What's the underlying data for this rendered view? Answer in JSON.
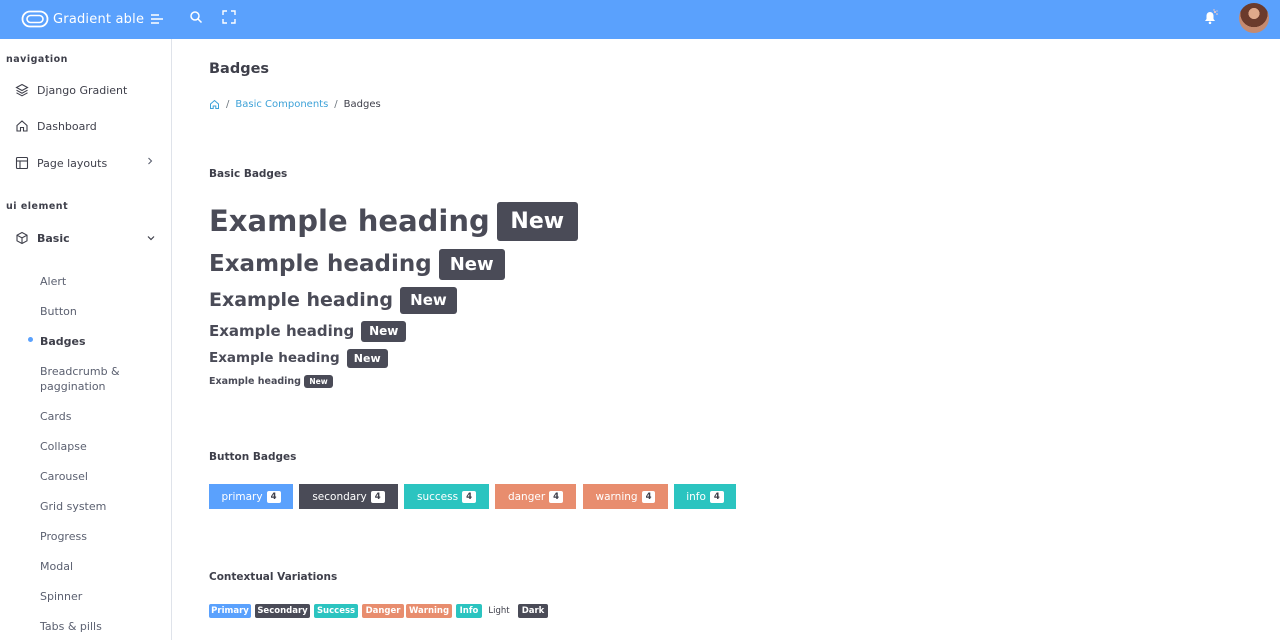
{
  "header": {
    "logo_text": "Gradient able",
    "bar_color": "#5aa1fd",
    "icons": [
      "menu-icon",
      "search-icon",
      "fullscreen-icon",
      "bell-icon",
      "avatar"
    ]
  },
  "sidebar": {
    "caption_navigation": "navigation",
    "items_navigation": [
      {
        "label": "Django Gradient",
        "icon": "layers-icon"
      },
      {
        "label": "Dashboard",
        "icon": "home-icon"
      },
      {
        "label": "Page layouts",
        "icon": "layout-icon"
      }
    ],
    "caption_ui": "ui element",
    "basic": {
      "label": "Basic",
      "icon": "box-icon"
    },
    "sub_items": [
      "Alert",
      "Button",
      "Badges",
      "Breadcrumb &",
      "paggination",
      "Cards",
      "Collapse",
      "Carousel",
      "Grid system",
      "Progress",
      "Modal",
      "Spinner",
      "Tabs & pills"
    ]
  },
  "page": {
    "title": "Badges",
    "breadcrumb": {
      "link": "Basic Components",
      "current": "Badges"
    }
  },
  "basic_badges": {
    "title": "Basic Badges",
    "heading_text": "Example heading",
    "badge_text": "New"
  },
  "button_badges": {
    "title": "Button Badges",
    "buttons": [
      {
        "label": "primary",
        "count": "4",
        "color": "#5aa1fd"
      },
      {
        "label": "secondary",
        "count": "4",
        "color": "#4a4b57"
      },
      {
        "label": "success",
        "count": "4",
        "color": "#2bc4c0"
      },
      {
        "label": "danger",
        "count": "4",
        "color": "#e88d6e"
      },
      {
        "label": "warning",
        "count": "4",
        "color": "#e88d6e"
      },
      {
        "label": "info",
        "count": "4",
        "color": "#2bc4c0"
      }
    ]
  },
  "contextual": {
    "title": "Contextual Variations",
    "badges": [
      "Primary",
      "Secondary",
      "Success",
      "Danger",
      "Warning",
      "Info",
      "Light",
      "Dark"
    ]
  }
}
